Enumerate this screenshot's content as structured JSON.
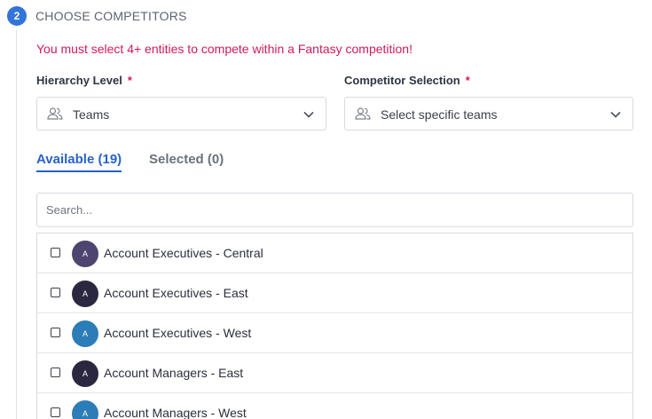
{
  "step": {
    "number": "2",
    "title": "CHOOSE COMPETITORS"
  },
  "warning": "You must select 4+ entities to compete within a Fantasy competition!",
  "hierarchy": {
    "label": "Hierarchy Level",
    "required_mark": "*",
    "value": "Teams",
    "icon": "people-icon"
  },
  "competitor": {
    "label": "Competitor Selection",
    "required_mark": "*",
    "value": "Select specific teams",
    "icon": "people-icon"
  },
  "tabs": [
    {
      "label": "Available (19)",
      "active": true
    },
    {
      "label": "Selected (0)",
      "active": false
    }
  ],
  "search": {
    "placeholder": "Search..."
  },
  "items": [
    {
      "initial": "A",
      "name": "Account Executives - Central",
      "color": "#4d4470",
      "checked": false
    },
    {
      "initial": "A",
      "name": "Account Executives - East",
      "color": "#2c2740",
      "checked": false
    },
    {
      "initial": "A",
      "name": "Account Executives - West",
      "color": "#2b7cb7",
      "checked": false
    },
    {
      "initial": "A",
      "name": "Account Managers - East",
      "color": "#2c2740",
      "checked": false
    },
    {
      "initial": "A",
      "name": "Account Managers - West",
      "color": "#2b7cb7",
      "checked": false
    }
  ],
  "colors": {
    "accent": "#3273dc",
    "tab_active": "#2762c9",
    "warning": "#d1195b"
  }
}
